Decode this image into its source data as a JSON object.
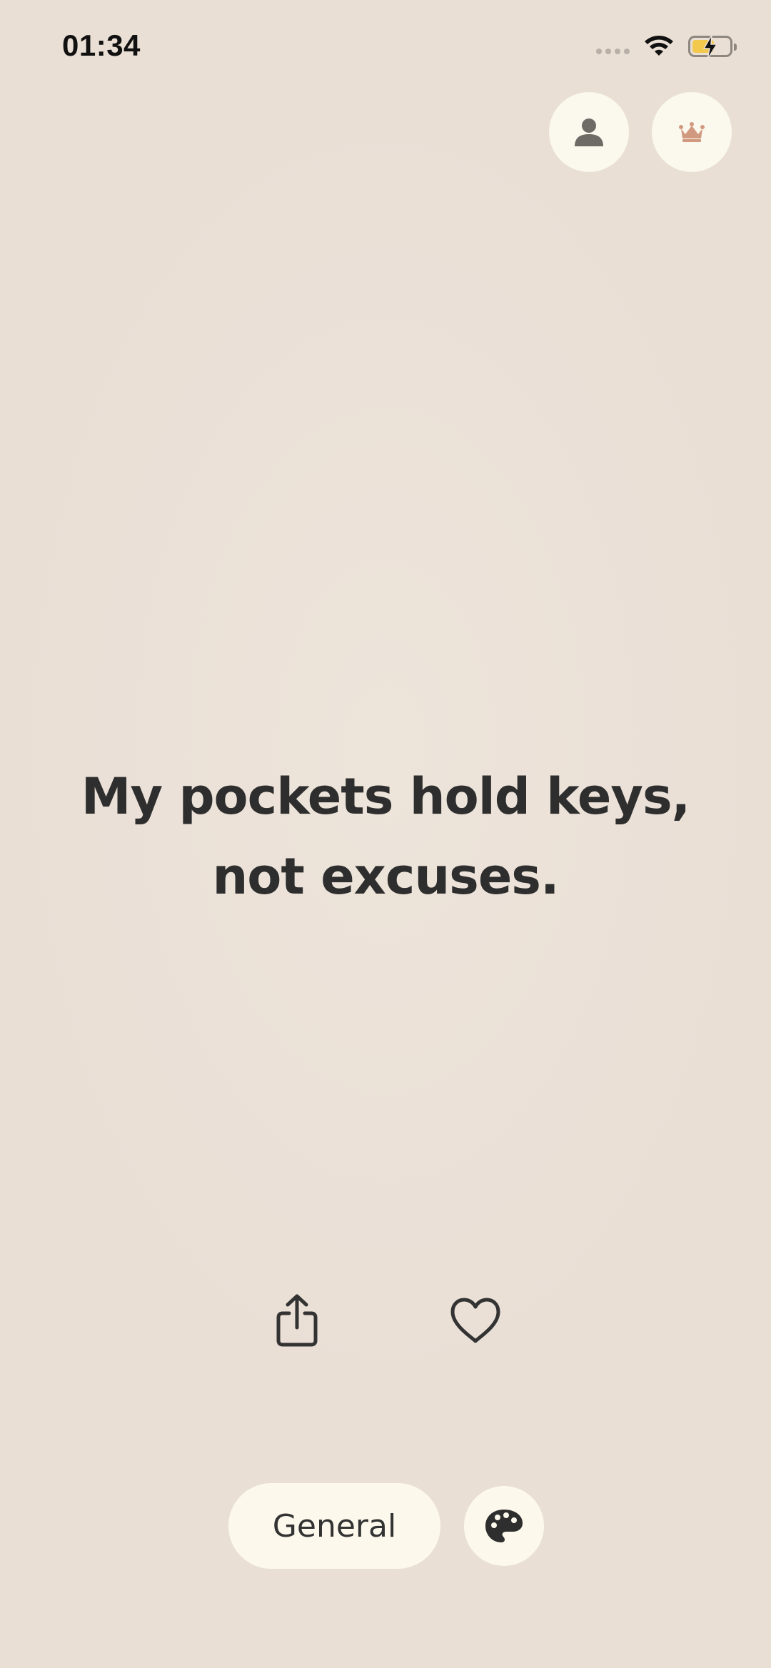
{
  "status_bar": {
    "time": "01:34",
    "battery_level": 0.6,
    "charging": true
  },
  "header": {
    "profile_icon": "person-icon",
    "premium_icon": "crown-icon"
  },
  "quote": {
    "line1": "My pockets hold keys,",
    "line2": "not excuses."
  },
  "actions": {
    "share_icon": "share-icon",
    "like_icon": "heart-icon"
  },
  "bottom_bar": {
    "category_label": "General",
    "theme_icon": "palette-icon"
  },
  "colors": {
    "background": "#ebe1d8",
    "button_bg": "#fcf9ec",
    "text": "#2e2e2e",
    "crown": "#d19a80",
    "battery": "#f2c94c"
  }
}
